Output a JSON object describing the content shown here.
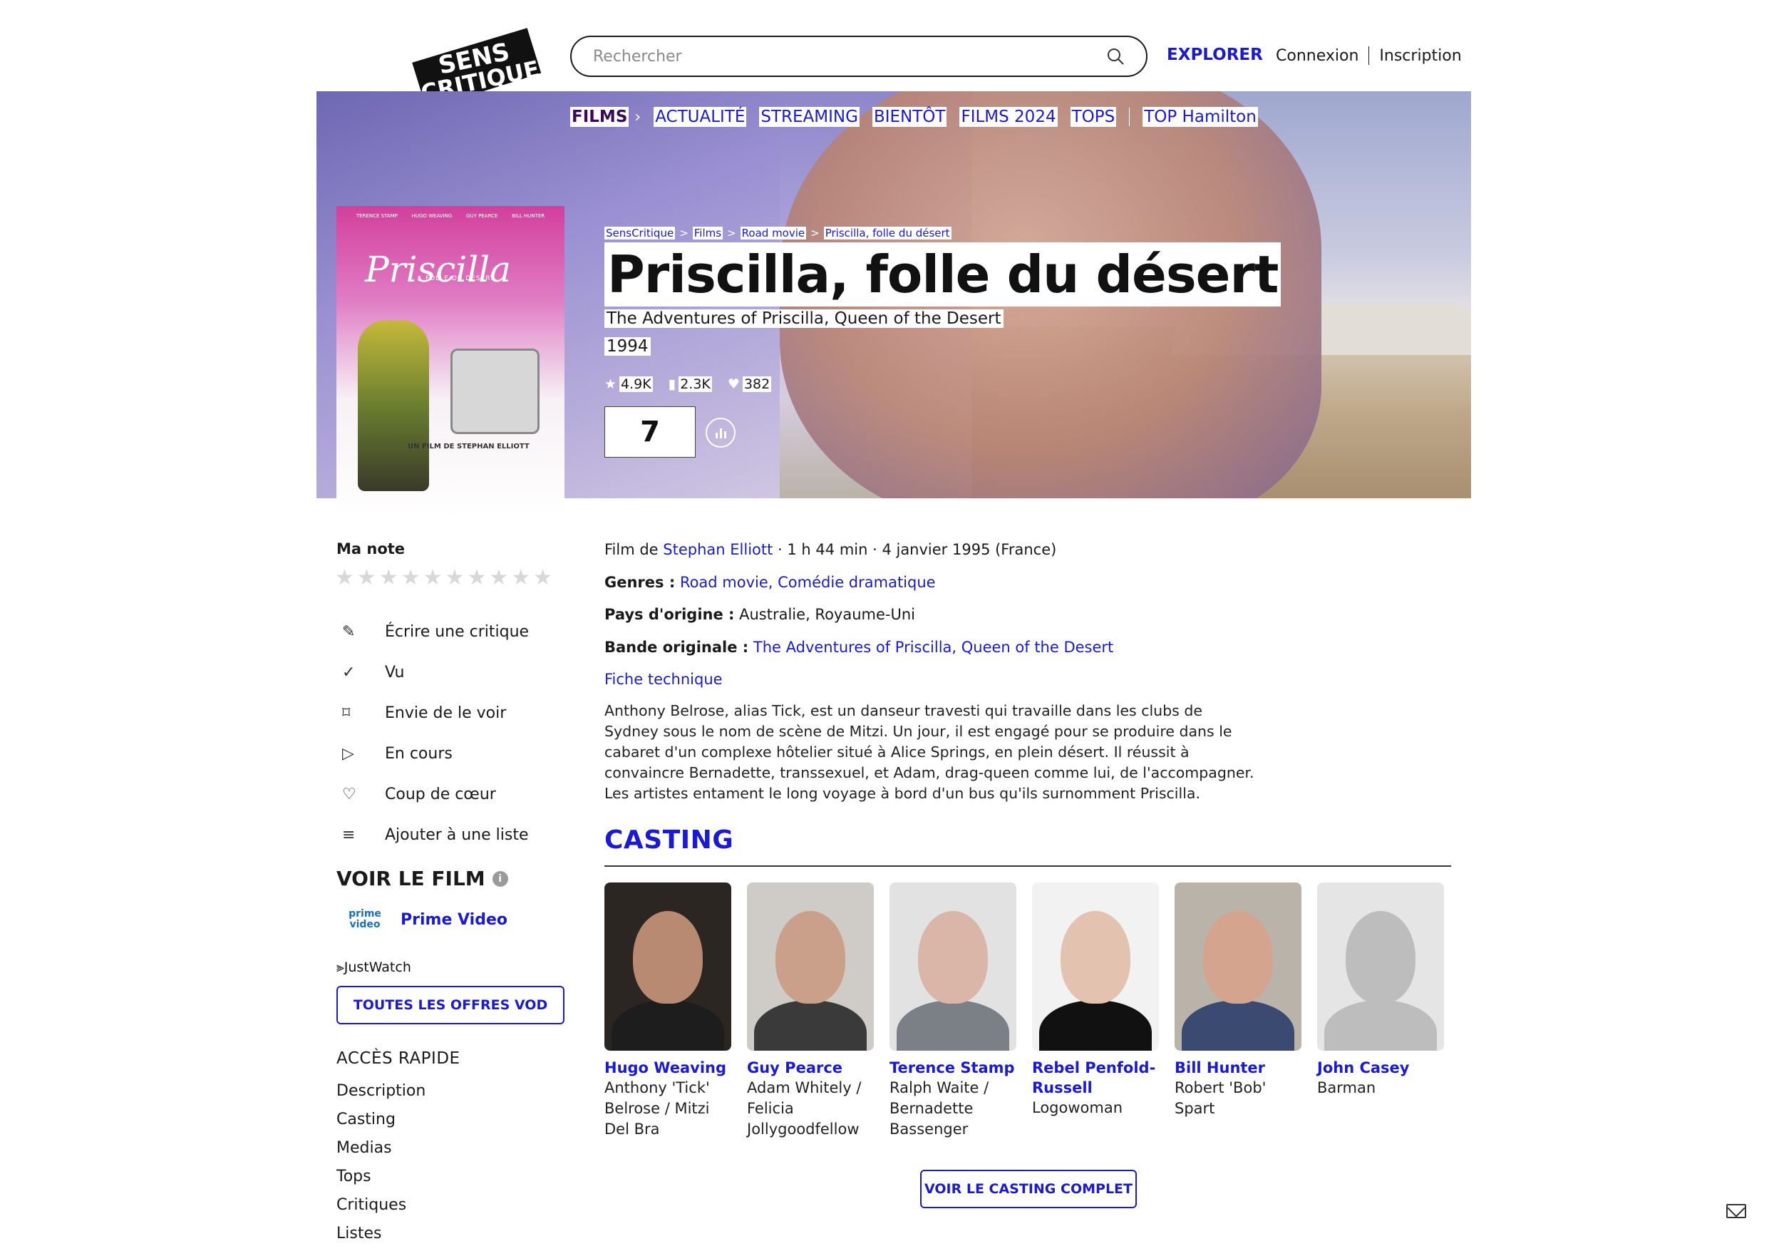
{
  "header": {
    "logo_text": "SENS CRITIQUE",
    "search_placeholder": "Rechercher",
    "explorer": "EXPLORER",
    "login": "Connexion",
    "signup": "Inscription"
  },
  "subnav": {
    "active": "FILMS",
    "items": [
      "ACTUALITÉ",
      "STREAMING",
      "BIENTÔT",
      "FILMS 2024",
      "TOPS"
    ],
    "extra": "TOP Hamilton"
  },
  "breadcrumb": [
    "SensCritique",
    "Films",
    "Road movie",
    "Priscilla, folle du désert"
  ],
  "movie": {
    "title": "Priscilla, folle du désert",
    "original_title": "The Adventures of Priscilla, Queen of the Desert",
    "year": "1994",
    "ratings_count": "4.9K",
    "wishlist_count": "2.3K",
    "favorites_count": "382",
    "score": "7"
  },
  "poster": {
    "title": "Priscilla",
    "subtitle": "FOLLE DU DÉSERT",
    "director_line": "UN FILM DE STEPHAN ELLIOTT",
    "cast": [
      "TERENCE STAMP",
      "HUGO WEAVING",
      "GUY PEARCE",
      "BILL HUNTER"
    ]
  },
  "my_rating": {
    "label": "Ma note",
    "max": 10
  },
  "actions": [
    {
      "icon": "pencil-icon",
      "label": "Écrire une critique"
    },
    {
      "icon": "check-icon",
      "label": "Vu"
    },
    {
      "icon": "bookmark-icon",
      "label": "Envie de le voir"
    },
    {
      "icon": "play-icon",
      "label": "En cours"
    },
    {
      "icon": "heart-icon",
      "label": "Coup de cœur"
    },
    {
      "icon": "list-add-icon",
      "label": "Ajouter à une liste"
    }
  ],
  "watch": {
    "title": "VOIR LE FILM",
    "provider_logo": "prime video",
    "provider": "Prime Video",
    "justwatch": "JustWatch",
    "vod_button": "TOUTES LES OFFRES VOD"
  },
  "quick_access": {
    "title": "ACCÈS RAPIDE",
    "items": [
      "Description",
      "Casting",
      "Medias",
      "Tops",
      "Critiques",
      "Listes"
    ]
  },
  "details": {
    "film_by": "Film de",
    "director": "Stephan Elliott",
    "info": " · 1 h 44 min · 4 janvier 1995 (France)",
    "genres_label": "Genres :",
    "genres": "Road movie, Comédie dramatique",
    "country_label": "Pays d'origine :",
    "countries": "Australie, Royaume-Uni",
    "soundtrack_label": "Bande originale :",
    "soundtrack": "The Adventures of Priscilla, Queen of the Desert",
    "tech_sheet": "Fiche technique"
  },
  "synopsis": "Anthony Belrose, alias Tick, est un danseur travesti qui travaille dans les clubs de Sydney sous le nom de scène de Mitzi. Un jour, il est engagé pour se produire dans le cabaret d'un complexe hôtelier situé à Alice Springs, en plein désert. Il réussit à convaincre Bernadette, transsexuel, et Adam, drag-queen comme lui, de l'accompagner. Les artistes entament le long voyage à bord d'un bus qu'ils surnomment Priscilla.",
  "casting": {
    "title": "CASTING",
    "full_button": "VOIR LE CASTING COMPLET",
    "actors": [
      {
        "name": "Hugo Weaving",
        "role": "Anthony 'Tick' Belrose / Mitzi Del Bra",
        "skin": "#b98a72",
        "bg": "#2b2622",
        "clothes": "#1d1d1d"
      },
      {
        "name": "Guy Pearce",
        "role": "Adam Whitely / Felicia Jollygoodfellow",
        "skin": "#caa08a",
        "bg": "#cfcbc6",
        "clothes": "#3a3a3a"
      },
      {
        "name": "Terence Stamp",
        "role": "Ralph Waite / Bernadette Bassenger",
        "skin": "#d9b6a8",
        "bg": "#e2e2e2",
        "clothes": "#7b7f86"
      },
      {
        "name": "Rebel Penfold-Russell",
        "role": "Logowoman",
        "skin": "#e3c2b0",
        "bg": "#f2f2f2",
        "clothes": "#111111"
      },
      {
        "name": "Bill Hunter",
        "role": "Robert 'Bob' Spart",
        "skin": "#d5a48e",
        "bg": "#b9b3aa",
        "clothes": "#3a4a70"
      },
      {
        "name": "John Casey",
        "role": "Barman",
        "skin": "#bdbdbd",
        "bg": "#e5e5e5",
        "clothes": "#bdbdbd"
      }
    ]
  },
  "colors": {
    "accent": "#1a1ad4",
    "text": "#1a1a1a"
  }
}
